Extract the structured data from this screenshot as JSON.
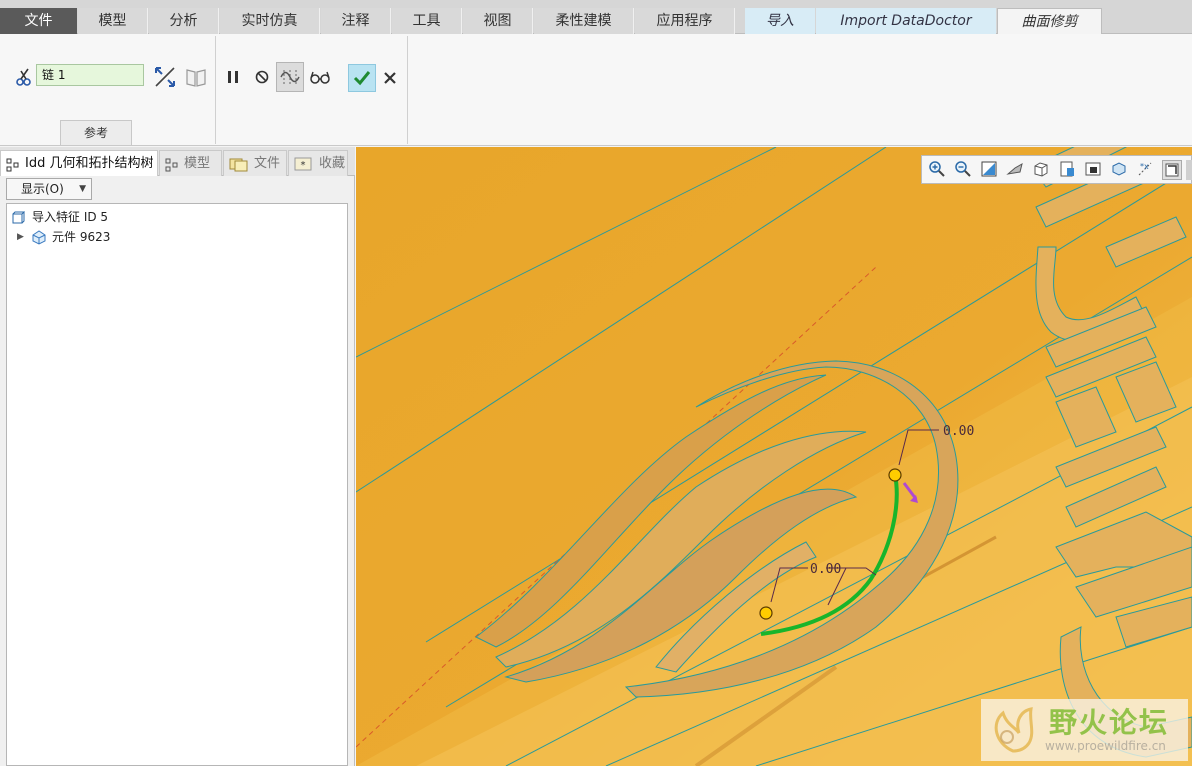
{
  "tabs": {
    "file": "文件",
    "model": "模型",
    "analysis": "分析",
    "simulate": "实时仿真",
    "annotate": "注释",
    "tools": "工具",
    "view": "视图",
    "flexible": "柔性建模",
    "apps": "应用程序",
    "import": "导入",
    "datadoctor": "Import DataDoctor",
    "trim": "曲面修剪"
  },
  "ribbon": {
    "chain_value": "链 1",
    "reference_label": "参考",
    "icons": [
      "scissors-icon",
      "flip-arrows-icon",
      "book-icon",
      "pause-icon",
      "no-icon",
      "preview-icon",
      "glasses-icon",
      "check-icon",
      "close-icon"
    ]
  },
  "panel": {
    "tabs": [
      "Idd 几何和拓扑结构树",
      "模型",
      "文件",
      "收藏"
    ],
    "display_button": "显示(O)",
    "tree": [
      {
        "label": "导入特征 ID 5",
        "icon": "cube-icon"
      },
      {
        "label": "元件 9623",
        "icon": "component-icon"
      }
    ]
  },
  "viewport": {
    "dimension_label_1": "0.00",
    "dimension_label_2": "0.00",
    "model_letters": "CIVNEIFIRE",
    "colors": {
      "background": "#e8a62a",
      "highlight": "#18b52b",
      "edge": "#2a9a9a",
      "handle": "#ffcc00"
    }
  },
  "watermark": {
    "title": "野火论坛",
    "url": "www.proewildfire.cn"
  }
}
